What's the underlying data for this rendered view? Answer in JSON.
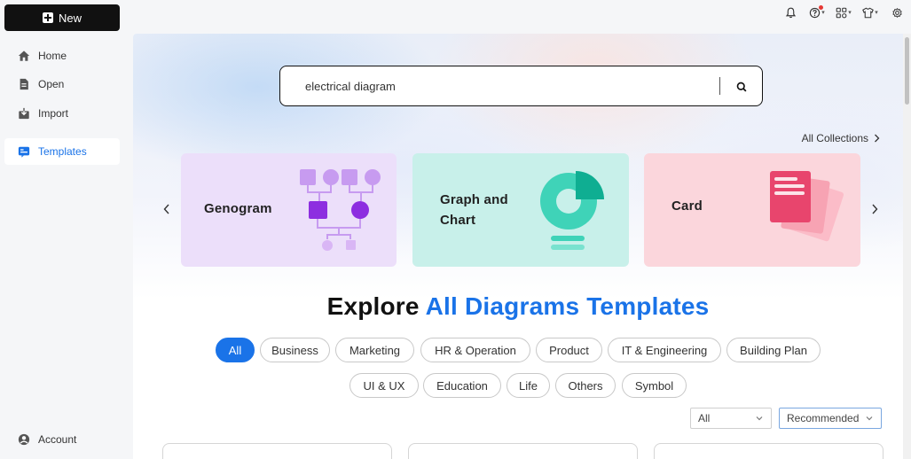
{
  "sidebar": {
    "new_label": "New",
    "items": [
      {
        "label": "Home",
        "icon": "home-icon"
      },
      {
        "label": "Open",
        "icon": "document-icon"
      },
      {
        "label": "Import",
        "icon": "import-icon"
      },
      {
        "label": "Templates",
        "icon": "templates-icon",
        "active": true
      }
    ],
    "account_label": "Account"
  },
  "topbar": {
    "icons": [
      "bell-icon",
      "help-icon",
      "apps-icon",
      "shirt-icon",
      "settings-icon"
    ]
  },
  "search": {
    "value": "electrical diagram"
  },
  "collections": {
    "label": "All Collections",
    "cards": [
      {
        "title": "Genogram",
        "color": "#ecdffa"
      },
      {
        "title_line1": "Graph and",
        "title_line2": "Chart",
        "color": "#c8f0ea"
      },
      {
        "title": "Card",
        "color": "#fbd6dc"
      }
    ]
  },
  "explore": {
    "prefix": "Explore",
    "accent": "All Diagrams Templates",
    "accent_color": "#1a73e8"
  },
  "tags": [
    "All",
    "Business",
    "Marketing",
    "HR & Operation",
    "Product",
    "IT & Engineering",
    "Building Plan",
    "UI & UX",
    "Education",
    "Life",
    "Others",
    "Symbol"
  ],
  "filters": {
    "type_value": "All",
    "sort_value": "Recommended"
  },
  "colors": {
    "accent": "#1a73e8",
    "new_button_bg": "#111111"
  }
}
